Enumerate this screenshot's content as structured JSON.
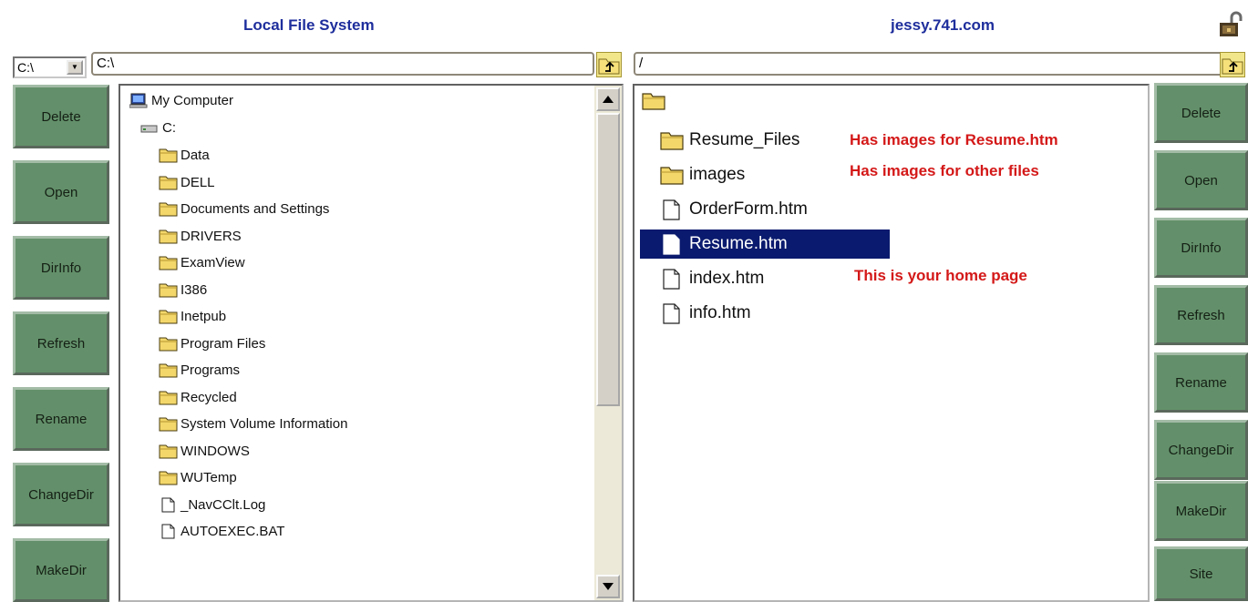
{
  "local": {
    "title": "Local File System",
    "drive": "C:\\",
    "path": "C:\\",
    "buttons": [
      "Delete",
      "Open",
      "DirInfo",
      "Refresh",
      "Rename",
      "ChangeDir",
      "MakeDir"
    ],
    "tree": [
      {
        "label": "My Computer",
        "icon": "computer-icon",
        "level": 0
      },
      {
        "label": "C:",
        "icon": "drive-icon",
        "level": 1
      },
      {
        "label": "Data",
        "icon": "folder-icon",
        "level": 2
      },
      {
        "label": "DELL",
        "icon": "folder-icon",
        "level": 2
      },
      {
        "label": "Documents and Settings",
        "icon": "folder-icon",
        "level": 2
      },
      {
        "label": "DRIVERS",
        "icon": "folder-icon",
        "level": 2
      },
      {
        "label": "ExamView",
        "icon": "folder-icon",
        "level": 2
      },
      {
        "label": "I386",
        "icon": "folder-icon",
        "level": 2
      },
      {
        "label": "Inetpub",
        "icon": "folder-icon",
        "level": 2
      },
      {
        "label": "Program Files",
        "icon": "folder-icon",
        "level": 2
      },
      {
        "label": "Programs",
        "icon": "folder-icon",
        "level": 2
      },
      {
        "label": "Recycled",
        "icon": "folder-icon",
        "level": 2
      },
      {
        "label": "System Volume Information",
        "icon": "folder-icon",
        "level": 2
      },
      {
        "label": "WINDOWS",
        "icon": "folder-icon",
        "level": 2
      },
      {
        "label": "WUTemp",
        "icon": "folder-icon",
        "level": 2
      },
      {
        "label": "_NavCClt.Log",
        "icon": "file-icon",
        "level": 2
      },
      {
        "label": "AUTOEXEC.BAT",
        "icon": "file-icon",
        "level": 2
      }
    ]
  },
  "remote": {
    "title": "jessy.741.com",
    "path": "/",
    "buttons": [
      "Delete",
      "Open",
      "DirInfo",
      "Refresh",
      "Rename",
      "ChangeDir",
      "MakeDir",
      "Site"
    ],
    "items": [
      {
        "label": "Resume_Files",
        "icon": "folder-icon",
        "selected": false
      },
      {
        "label": "images",
        "icon": "folder-icon",
        "selected": false
      },
      {
        "label": "OrderForm.htm",
        "icon": "file-icon",
        "selected": false
      },
      {
        "label": "Resume.htm",
        "icon": "file-icon",
        "selected": true
      },
      {
        "label": "index.htm",
        "icon": "file-icon",
        "selected": false
      },
      {
        "label": "info.htm",
        "icon": "file-icon",
        "selected": false
      }
    ],
    "notes": [
      "Has images for Resume.htm",
      "Has images for other files",
      "This is your home page"
    ]
  },
  "colors": {
    "title": "#1e2e9c",
    "button_bg": "#63906a",
    "note": "#d41818",
    "selection": "#0a1a6e"
  }
}
